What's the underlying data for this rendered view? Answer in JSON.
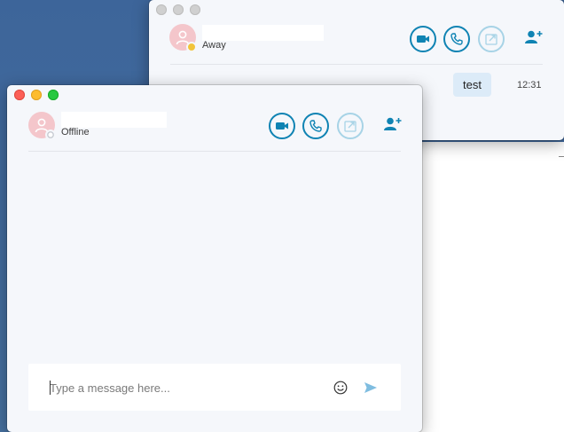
{
  "back_window": {
    "contact_status": "Away",
    "message": {
      "text": "test",
      "time": "12:31"
    }
  },
  "front_window": {
    "contact_status": "Offline",
    "composer": {
      "placeholder": "Type a message here...",
      "value": ""
    }
  },
  "icons": {
    "video": "video-camera-icon",
    "call": "phone-icon",
    "share": "share-screen-icon",
    "add": "add-person-icon",
    "emoji": "smiley-icon",
    "send": "send-arrow-icon"
  },
  "colors": {
    "accent": "#0f83b3",
    "accent_dim": "#a7d3e6",
    "away": "#f2c43a",
    "bubble": "#dcebf8"
  }
}
